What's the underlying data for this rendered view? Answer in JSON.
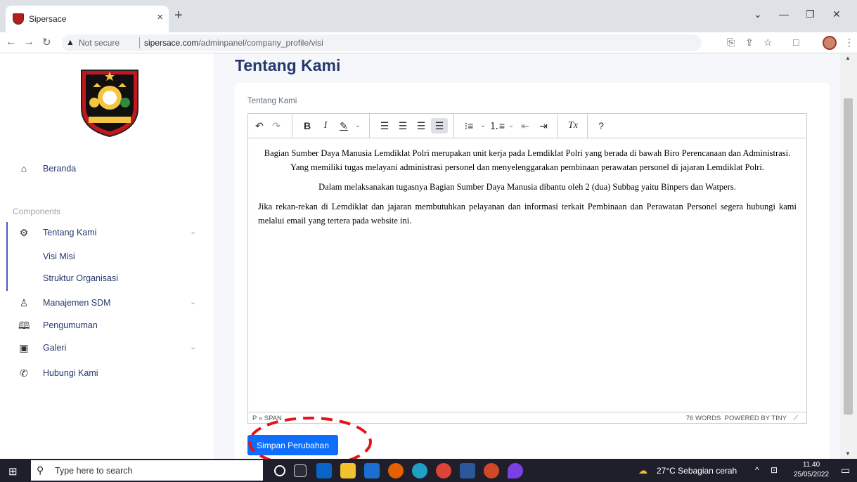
{
  "browser": {
    "tab_title": "Sipersace",
    "tab_close": "×",
    "new_tab": "+",
    "security_label": "Not secure",
    "url_host": "sipersace.com",
    "url_path": "/adminpanel/company_profile/visi"
  },
  "sidebar": {
    "section_label": "Components",
    "items": [
      {
        "label": "Beranda",
        "icon": "home-icon"
      },
      {
        "label": "Tentang Kami",
        "icon": "gear-icon"
      },
      {
        "label": "Manajemen SDM",
        "icon": "user-icon"
      },
      {
        "label": "Pengumuman",
        "icon": "book-icon"
      },
      {
        "label": "Galeri",
        "icon": "image-icon"
      },
      {
        "label": "Hubungi Kami",
        "icon": "phone-icon"
      }
    ],
    "sub_items": [
      "Visi Misi",
      "Struktur Organisasi"
    ]
  },
  "main": {
    "title": "Tentang Kami",
    "field_label": "Tentang Kami",
    "content": {
      "p1": "Bagian Sumber Daya Manusia Lemdiklat Polri merupakan unit kerja pada Lemdiklat Polri yang berada di bawah Biro Perencanaan dan Administrasi. Yang memiliki tugas melayani administrasi personel dan menyelenggarakan pembinaan perawatan personel di jajaran Lemdiklat Polri.",
      "p2": "Dalam melaksanakan tugasnya Bagian Sumber Daya Manusia dibantu oleh 2 (dua) Subbag yaitu Binpers dan Watpers.",
      "p3": "Jika rekan-rekan di Lemdiklat dan jajaran membutuhkan pelayanan dan informasi terkait Pembinaan dan Perawatan Personel segera hubungi kami melalui email yang tertera pada website ini."
    },
    "status_path": "P » SPAN",
    "word_count": "76 WORDS",
    "powered_by": "POWERED BY TINY",
    "save_button": "Simpan Perubahan",
    "annotation_color": "#e3141b"
  },
  "taskbar": {
    "search_placeholder": "Type here to search",
    "weather": "27°C  Sebagian cerah",
    "time": "11.40",
    "date": "25/05/2022"
  }
}
